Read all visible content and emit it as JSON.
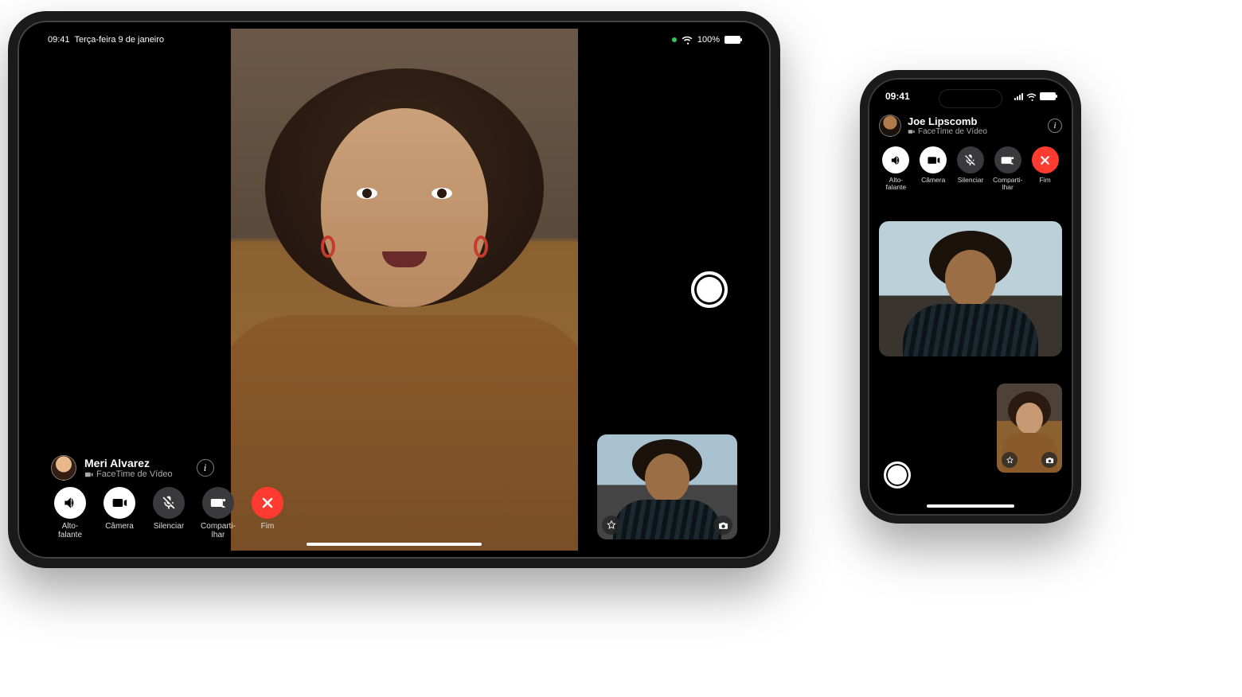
{
  "ipad": {
    "statusbar": {
      "time": "09:41",
      "date": "Terça-feira 9 de janeiro",
      "battery_label": "100%"
    },
    "caller": {
      "name": "Meri Alvarez",
      "subtitle": "FaceTime de Vídeo"
    },
    "controls": {
      "speaker": "Alto-falante",
      "camera": "Câmera",
      "mute": "Silenciar",
      "share": "Comparti-\nlhar",
      "end": "Fim"
    }
  },
  "iphone": {
    "statusbar": {
      "time": "09:41"
    },
    "caller": {
      "name": "Joe Lipscomb",
      "subtitle": "FaceTime de Vídeo"
    },
    "controls": {
      "speaker": "Alto-falante",
      "camera": "Câmera",
      "mute": "Silenciar",
      "share": "Comparti-\nlhar",
      "end": "Fim"
    }
  },
  "colors": {
    "end_red": "#ff3b30",
    "active_white": "#ffffff",
    "inactive_gray": "#3a3a3c"
  }
}
